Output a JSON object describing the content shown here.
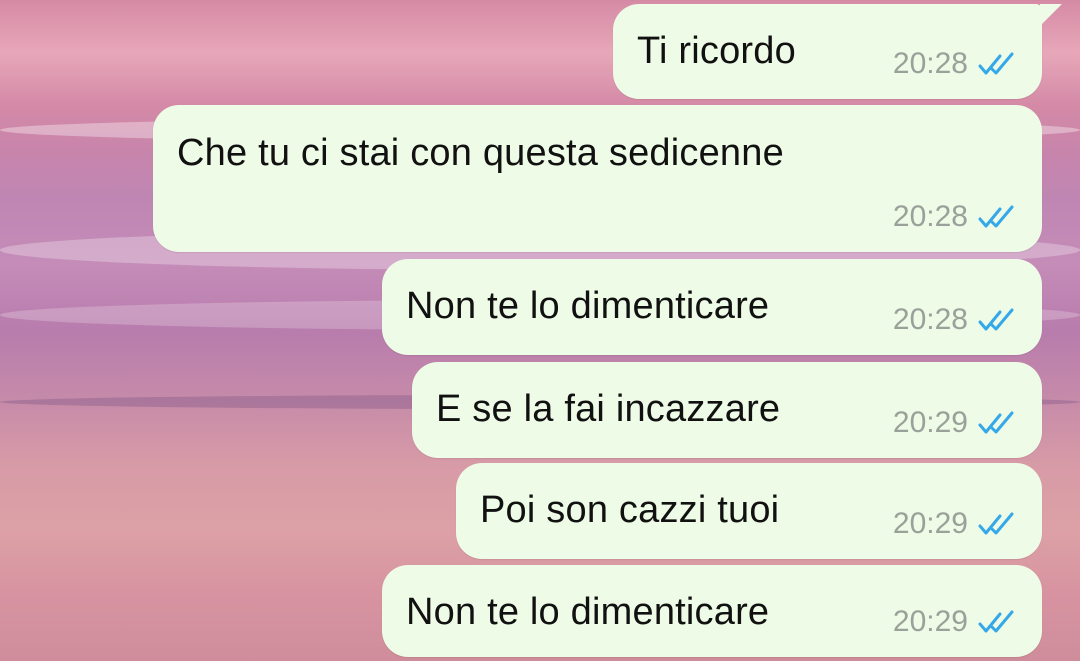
{
  "messages": [
    {
      "text": "Ti ricordo",
      "time": "20:28"
    },
    {
      "text": "Che tu ci stai con questa sedicenne",
      "time": "20:28"
    },
    {
      "text": "Non te lo dimenticare",
      "time": "20:28"
    },
    {
      "text": "E se la fai incazzare",
      "time": "20:29"
    },
    {
      "text": "Poi son cazzi tuoi",
      "time": "20:29"
    },
    {
      "text": "Non te lo dimenticare",
      "time": "20:29"
    }
  ],
  "colors": {
    "bubble": "#eefbe6",
    "read_check": "#34a8e8",
    "time": "#9aa19a"
  },
  "icons": {
    "read_receipt": "double-check-icon"
  }
}
